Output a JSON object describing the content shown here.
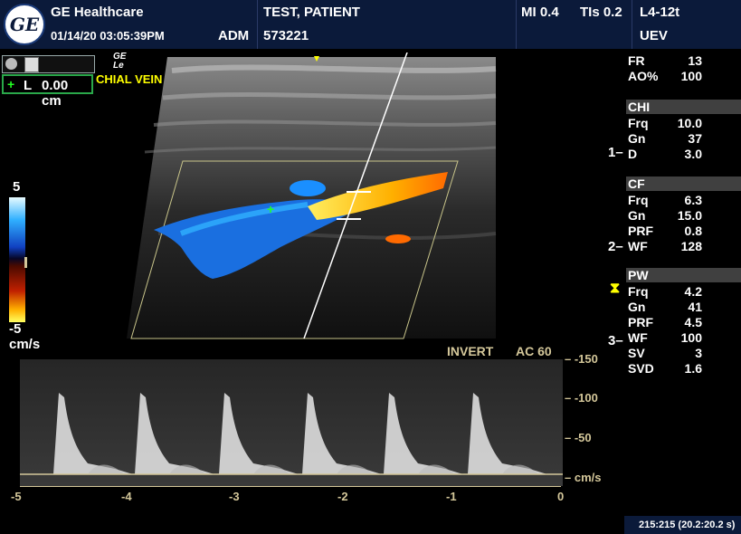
{
  "header": {
    "brand": "GE Healthcare",
    "datetime": "01/14/20 03:05:39PM",
    "operator": "ADM",
    "patient_name": "TEST, PATIENT",
    "patient_id": "573221",
    "mi": "MI 0.4",
    "tis": "TIs 0.2",
    "probe": "L4-12t",
    "preset": "UEV"
  },
  "logo_text": "GE",
  "image_label": {
    "brand_small_1": "GE",
    "brand_small_2": "Le",
    "title": "CHIAL VEIN AND ARTERY"
  },
  "measure": {
    "label": "L",
    "value": "0.00 cm"
  },
  "color_bar": {
    "top": "5",
    "bottom": "-5",
    "unit": "cm/s"
  },
  "depth_marks": [
    "1",
    "2",
    "3"
  ],
  "params": {
    "general": [
      {
        "k": "FR",
        "v": "13"
      },
      {
        "k": "AO%",
        "v": "100"
      }
    ],
    "chi_title": "CHI",
    "chi": [
      {
        "k": "Frq",
        "v": "10.0"
      },
      {
        "k": "Gn",
        "v": "37"
      },
      {
        "k": "D",
        "v": "3.0"
      }
    ],
    "cf_title": "CF",
    "cf": [
      {
        "k": "Frq",
        "v": "6.3"
      },
      {
        "k": "Gn",
        "v": "15.0"
      },
      {
        "k": "PRF",
        "v": "0.8"
      },
      {
        "k": "WF",
        "v": "128"
      }
    ],
    "pw_title": "PW",
    "pw": [
      {
        "k": "Frq",
        "v": "4.2"
      },
      {
        "k": "Gn",
        "v": "41"
      },
      {
        "k": "PRF",
        "v": "4.5"
      },
      {
        "k": "WF",
        "v": "100"
      },
      {
        "k": "SV",
        "v": "3"
      },
      {
        "k": "SVD",
        "v": "1.6"
      }
    ]
  },
  "spectral": {
    "invert_label": "INVERT",
    "ac_label": "AC 60",
    "unit": "cm/s",
    "y_ticks": [
      "-150",
      "-100",
      "-50"
    ],
    "x_ticks": [
      "-5",
      "-4",
      "-3",
      "-2",
      "-1",
      "0"
    ]
  },
  "status_bar": "215:215  (20.2:20.2 s)"
}
